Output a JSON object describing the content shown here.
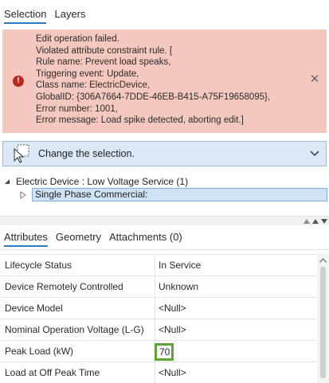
{
  "tabs": {
    "selection": "Selection",
    "layers": "Layers"
  },
  "error": {
    "icon": "error-icon",
    "lines": [
      "Edit operation failed.",
      "Violated attribute constraint rule. [",
      "Rule name: Prevent load speaks,",
      "Triggering event: Update,",
      "Class name: ElectricDevice,",
      "GlobalID: {306A7664-7DDE-46EB-B415-A75F19658095},",
      "Error number: 1001,",
      "Error message: Load spike detected, aborting edit.]"
    ],
    "close_icon": "close-icon",
    "background_color": "#f4c8bf",
    "icon_color": "#b5291f"
  },
  "selection_bar": {
    "label": "Change the selection.",
    "icon": "change-selection-icon",
    "chevron": "chevron-down-icon"
  },
  "tree": {
    "root_label": "Electric Device : Low Voltage Service (1)",
    "child_label": "Single Phase Commercial:"
  },
  "attribute_tabs": {
    "attributes": "Attributes",
    "geometry": "Geometry",
    "attachments": "Attachments (0)"
  },
  "attributes": [
    {
      "name": "Lifecycle Status",
      "value": "In Service"
    },
    {
      "name": "Device Remotely Controlled",
      "value": "Unknown"
    },
    {
      "name": "Device Model",
      "value": "<Null>"
    },
    {
      "name": "Nominal Operation Voltage (L-G)",
      "value": "<Null>"
    },
    {
      "name": "Peak Load (kW)",
      "value": "70"
    },
    {
      "name": "Load at Off Peak Time",
      "value": "<Null>"
    }
  ],
  "colors": {
    "accent": "#2d7ac6",
    "highlight_border": "#5ea537",
    "selection_background": "#dbe8f7"
  }
}
